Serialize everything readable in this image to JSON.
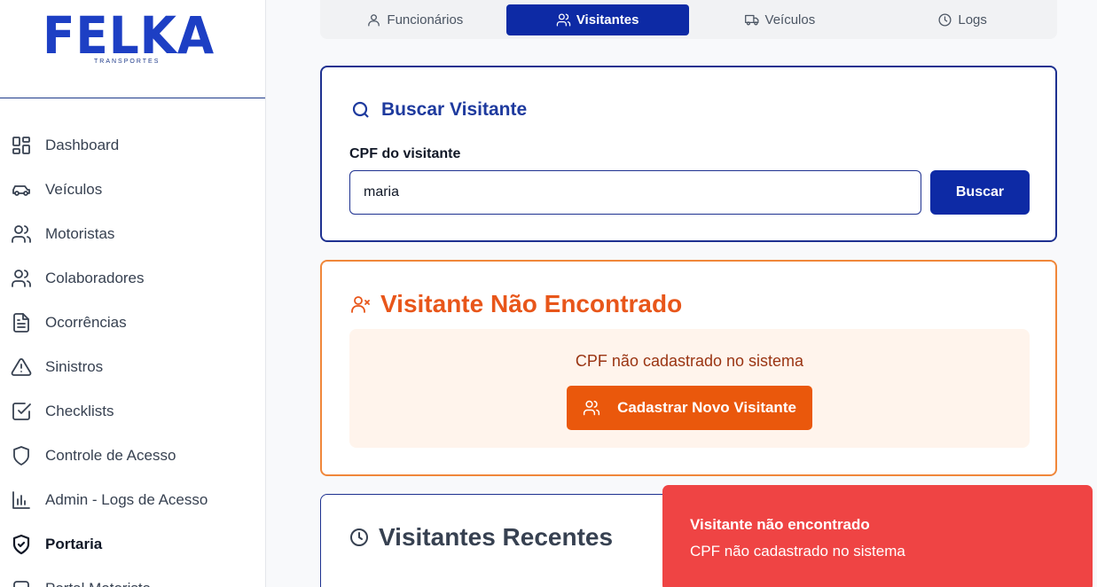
{
  "brand": {
    "name": "FELKA",
    "subtitle": "TRANSPORTES"
  },
  "colors": {
    "primary": "#0d2aa5",
    "accent_orange": "#ea580c",
    "danger": "#ef4444"
  },
  "sidebar": {
    "items": [
      {
        "label": "Dashboard",
        "icon": "dashboard-icon"
      },
      {
        "label": "Veículos",
        "icon": "car-icon"
      },
      {
        "label": "Motoristas",
        "icon": "users-icon"
      },
      {
        "label": "Colaboradores",
        "icon": "users-icon"
      },
      {
        "label": "Ocorrências",
        "icon": "file-text-icon"
      },
      {
        "label": "Sinistros",
        "icon": "alert-triangle-icon"
      },
      {
        "label": "Checklists",
        "icon": "check-square-icon"
      },
      {
        "label": "Controle de Acesso",
        "icon": "shield-icon"
      },
      {
        "label": "Admin - Logs de Acesso",
        "icon": "bar-chart-icon"
      },
      {
        "label": "Portaria",
        "icon": "shield-check-icon",
        "active": true
      },
      {
        "label": "Portal Motorista",
        "icon": "square-icon"
      }
    ]
  },
  "tabs": [
    {
      "label": "Funcionários",
      "icon": "user-icon"
    },
    {
      "label": "Visitantes",
      "icon": "users-icon",
      "active": true
    },
    {
      "label": "Veículos",
      "icon": "truck-icon"
    },
    {
      "label": "Logs",
      "icon": "clock-icon"
    }
  ],
  "search": {
    "title": "Buscar Visitante",
    "field_label": "CPF do visitante",
    "value": "maria",
    "button_label": "Buscar"
  },
  "not_found": {
    "title": "Visitante Não Encontrado",
    "message": "CPF não cadastrado no sistema",
    "button_label": "Cadastrar Novo Visitante"
  },
  "recent": {
    "title": "Visitantes Recentes"
  },
  "toast": {
    "title": "Visitante não encontrado",
    "description": "CPF não cadastrado no sistema"
  }
}
